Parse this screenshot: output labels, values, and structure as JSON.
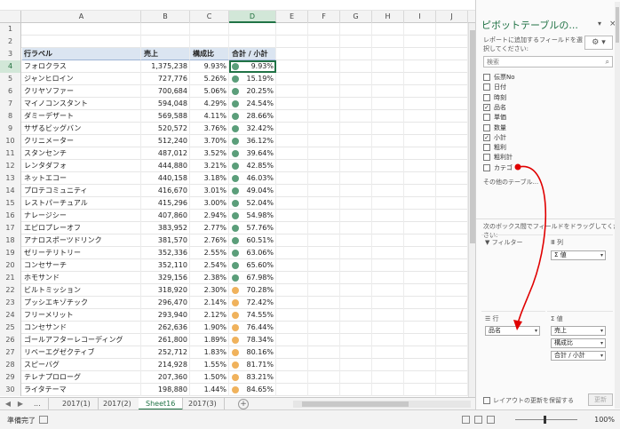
{
  "columns": [
    "A",
    "B",
    "C",
    "D",
    "E",
    "F",
    "G",
    "H",
    "I",
    "J"
  ],
  "pivot_header": {
    "row_label": "行ラベル",
    "sales": "売上",
    "ratio": "構成比",
    "cumulative": "合計 / 小計"
  },
  "rows": [
    {
      "n": "1",
      "name": "",
      "sales": "",
      "ratio": "",
      "cum": "",
      "dot": ""
    },
    {
      "n": "2",
      "name": "",
      "sales": "",
      "ratio": "",
      "cum": "",
      "dot": ""
    },
    {
      "n": "4",
      "name": "フォロクラス",
      "sales": "1,375,238",
      "ratio": "9.93%",
      "cum": "9.93%",
      "dot": "green"
    },
    {
      "n": "5",
      "name": "ジャンヒロイン",
      "sales": "727,776",
      "ratio": "5.26%",
      "cum": "15.19%",
      "dot": "green"
    },
    {
      "n": "6",
      "name": "クリヤソファー",
      "sales": "700,684",
      "ratio": "5.06%",
      "cum": "20.25%",
      "dot": "green"
    },
    {
      "n": "7",
      "name": "マイノコンスタント",
      "sales": "594,048",
      "ratio": "4.29%",
      "cum": "24.54%",
      "dot": "green"
    },
    {
      "n": "8",
      "name": "ダミーデザート",
      "sales": "569,588",
      "ratio": "4.11%",
      "cum": "28.66%",
      "dot": "green"
    },
    {
      "n": "9",
      "name": "サザるビッグバン",
      "sales": "520,572",
      "ratio": "3.76%",
      "cum": "32.42%",
      "dot": "green"
    },
    {
      "n": "10",
      "name": "クリニメーター",
      "sales": "512,240",
      "ratio": "3.70%",
      "cum": "36.12%",
      "dot": "green"
    },
    {
      "n": "11",
      "name": "スタンセンチ",
      "sales": "487,012",
      "ratio": "3.52%",
      "cum": "39.64%",
      "dot": "green"
    },
    {
      "n": "12",
      "name": "レンタダフォ",
      "sales": "444,880",
      "ratio": "3.21%",
      "cum": "42.85%",
      "dot": "green"
    },
    {
      "n": "13",
      "name": "ネットエコー",
      "sales": "440,158",
      "ratio": "3.18%",
      "cum": "46.03%",
      "dot": "green"
    },
    {
      "n": "14",
      "name": "プロテコミュニティ",
      "sales": "416,670",
      "ratio": "3.01%",
      "cum": "49.04%",
      "dot": "green"
    },
    {
      "n": "15",
      "name": "レストパーチュアル",
      "sales": "415,296",
      "ratio": "3.00%",
      "cum": "52.04%",
      "dot": "green"
    },
    {
      "n": "16",
      "name": "ナレージシー",
      "sales": "407,860",
      "ratio": "2.94%",
      "cum": "54.98%",
      "dot": "green"
    },
    {
      "n": "17",
      "name": "エピロプレーオフ",
      "sales": "383,952",
      "ratio": "2.77%",
      "cum": "57.76%",
      "dot": "green"
    },
    {
      "n": "18",
      "name": "アナロスポーツドリンク",
      "sales": "381,570",
      "ratio": "2.76%",
      "cum": "60.51%",
      "dot": "green"
    },
    {
      "n": "19",
      "name": "ゼリーテリトリー",
      "sales": "352,336",
      "ratio": "2.55%",
      "cum": "63.06%",
      "dot": "green"
    },
    {
      "n": "20",
      "name": "コンセサーチ",
      "sales": "352,110",
      "ratio": "2.54%",
      "cum": "65.60%",
      "dot": "green"
    },
    {
      "n": "21",
      "name": "ホモサンド",
      "sales": "329,156",
      "ratio": "2.38%",
      "cum": "67.98%",
      "dot": "green"
    },
    {
      "n": "22",
      "name": "ビルトミッション",
      "sales": "318,920",
      "ratio": "2.30%",
      "cum": "70.28%",
      "dot": "orange"
    },
    {
      "n": "23",
      "name": "プッシエキゾチック",
      "sales": "296,470",
      "ratio": "2.14%",
      "cum": "72.42%",
      "dot": "orange"
    },
    {
      "n": "24",
      "name": "フリーメリット",
      "sales": "293,940",
      "ratio": "2.12%",
      "cum": "74.55%",
      "dot": "orange"
    },
    {
      "n": "25",
      "name": "コンセサンド",
      "sales": "262,636",
      "ratio": "1.90%",
      "cum": "76.44%",
      "dot": "orange"
    },
    {
      "n": "26",
      "name": "ゴールアフターレコーディング",
      "sales": "261,800",
      "ratio": "1.89%",
      "cum": "78.34%",
      "dot": "orange"
    },
    {
      "n": "27",
      "name": "リベーエグゼクティブ",
      "sales": "252,712",
      "ratio": "1.83%",
      "cum": "80.16%",
      "dot": "orange"
    },
    {
      "n": "28",
      "name": "スピーバグ",
      "sales": "214,928",
      "ratio": "1.55%",
      "cum": "81.71%",
      "dot": "orange"
    },
    {
      "n": "29",
      "name": "テレナプロローグ",
      "sales": "207,360",
      "ratio": "1.50%",
      "cum": "83.21%",
      "dot": "orange"
    },
    {
      "n": "30",
      "name": "ライタテーマ",
      "sales": "198,880",
      "ratio": "1.44%",
      "cum": "84.65%",
      "dot": "orange"
    }
  ],
  "header_row_number": "3",
  "tabs": [
    "...",
    "2017(1)",
    "2017(2)",
    "Sheet16",
    "2017(3)"
  ],
  "tab_add": "+",
  "status": {
    "ready": "準備完了",
    "zoom": "100%"
  },
  "pane": {
    "title": "ピボットテーブルの...",
    "dropdown": "▾",
    "close": "×",
    "description": "レポートに追加するフィールドを選択してください:",
    "gear": "⚙ ▾",
    "search_placeholder": "検索",
    "search_icon": "⌕",
    "fields": [
      {
        "label": "伝票No",
        "checked": false
      },
      {
        "label": "日付",
        "checked": false
      },
      {
        "label": "時刻",
        "checked": false
      },
      {
        "label": "品名",
        "checked": true
      },
      {
        "label": "単価",
        "checked": false
      },
      {
        "label": "数量",
        "checked": false
      },
      {
        "label": "小計",
        "checked": true
      },
      {
        "label": "粗利",
        "checked": false
      },
      {
        "label": "粗利計",
        "checked": false
      },
      {
        "label": "カテゴ",
        "checked": false
      }
    ],
    "more_tables": "その他のテーブル...",
    "instruction": "次のボックス間でフィールドをドラッグしてください:",
    "area_filter": "▼ フィルター",
    "area_columns": "Ⅲ 列",
    "area_rows": "☰ 行",
    "area_values": "Σ 値",
    "column_chip": "Σ 値",
    "row_chip": "品名",
    "value_chips": [
      "売上",
      "構成比",
      "合計 / 小計"
    ],
    "defer_label": "レイアウトの更新を保留する",
    "update_button": "更新"
  },
  "colors": {
    "accent": "#217346",
    "arrow": "#e00000",
    "dot_green": "#5b9e7a",
    "dot_orange": "#f0b25c",
    "header_bg": "#dbe5f1"
  }
}
